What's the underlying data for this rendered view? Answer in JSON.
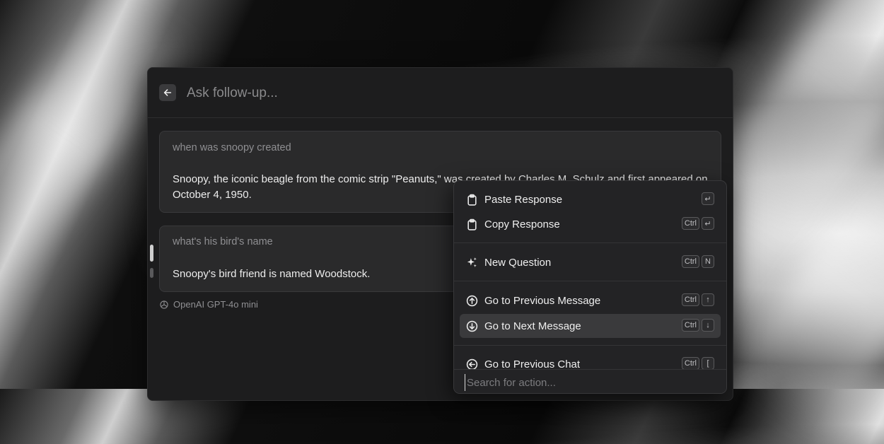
{
  "header": {
    "back_icon": "arrow-left-icon",
    "input_placeholder": "Ask follow-up..."
  },
  "conversation": [
    {
      "question": "when was snoopy created",
      "answer": "Snoopy, the iconic beagle from the comic strip \"Peanuts,\" was created by Charles M. Schulz and first appeared on October 4, 1950."
    },
    {
      "question": "what's his bird's name",
      "answer": "Snoopy's bird friend is named Woodstock."
    }
  ],
  "model": {
    "icon": "openai-icon",
    "label": "OpenAI GPT-4o mini"
  },
  "action_menu": {
    "items": [
      {
        "label": "Paste Response",
        "icon": "clipboard-icon",
        "keys": [
          "↵"
        ]
      },
      {
        "label": "Copy Response",
        "icon": "clipboard-icon",
        "keys": [
          "Ctrl",
          "↵"
        ]
      },
      {
        "label": "New Question",
        "icon": "sparkles-icon",
        "keys": [
          "Ctrl",
          "N"
        ]
      },
      {
        "label": "Go to Previous Message",
        "icon": "arrow-up-circle-icon",
        "keys": [
          "Ctrl",
          "↑"
        ]
      },
      {
        "label": "Go to Next Message",
        "icon": "arrow-down-circle-icon",
        "keys": [
          "Ctrl",
          "↓"
        ],
        "selected": true
      },
      {
        "label": "Go to Previous Chat",
        "icon": "arrow-left-circle-icon",
        "keys": [
          "Ctrl",
          "["
        ]
      }
    ],
    "search_placeholder": "Search for action..."
  }
}
